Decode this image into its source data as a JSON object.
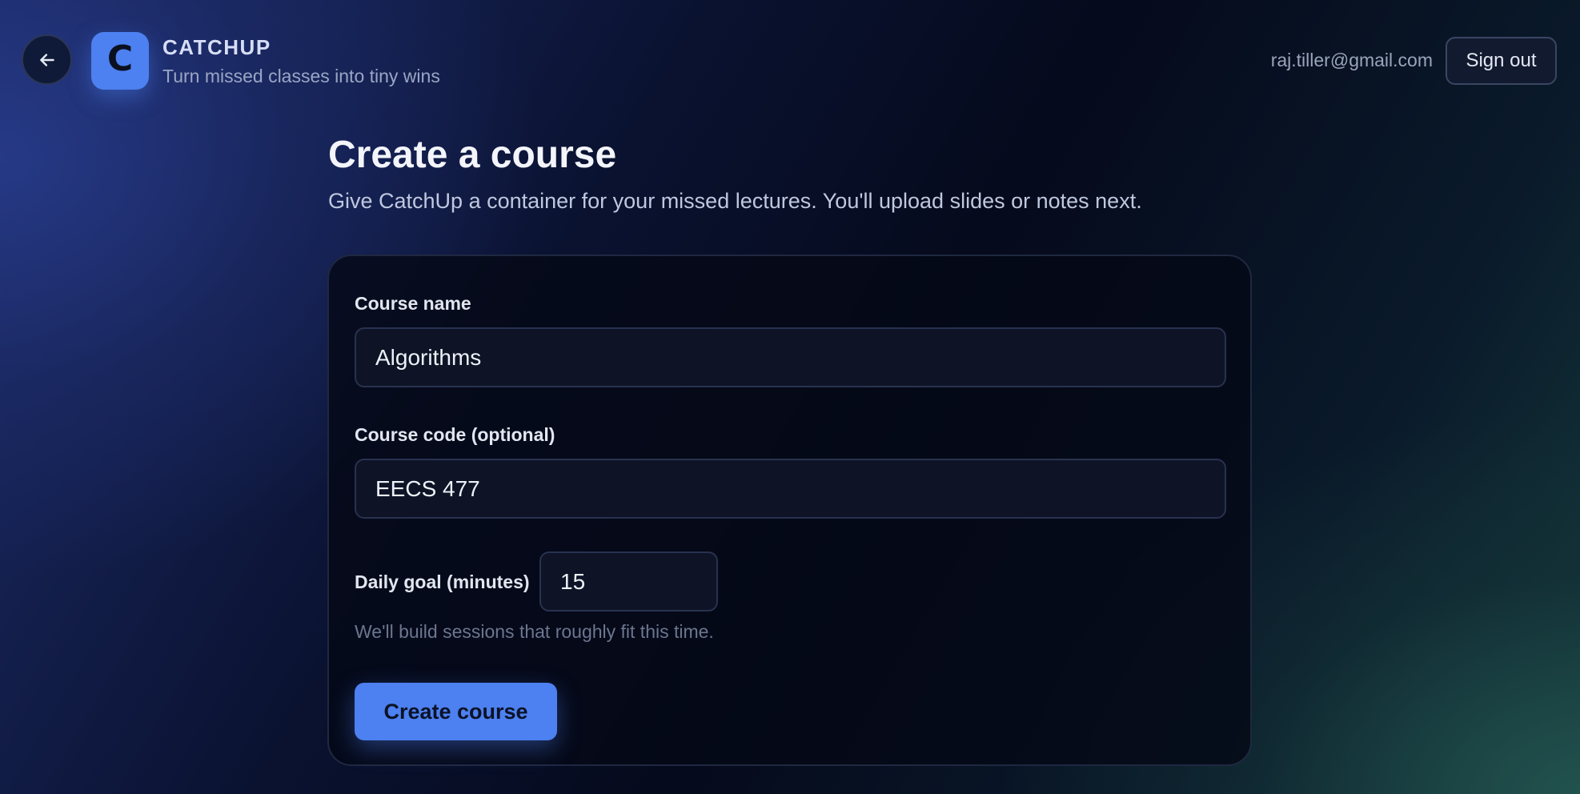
{
  "header": {
    "back_icon": "arrow-left-icon",
    "logo_letter": "C",
    "brand_name": "CATCHUP",
    "tagline": "Turn missed classes into tiny wins",
    "user_email": "raj.tiller@gmail.com",
    "sign_out_label": "Sign out"
  },
  "page": {
    "title": "Create a course",
    "subtitle": "Give CatchUp a container for your missed lectures. You'll upload slides or notes next."
  },
  "form": {
    "course_name": {
      "label": "Course name",
      "value": "Algorithms"
    },
    "course_code": {
      "label": "Course code (optional)",
      "value": "EECS 477"
    },
    "daily_goal": {
      "label": "Daily goal (minutes)",
      "value": "15",
      "hint": "We'll build sessions that roughly fit this time."
    },
    "submit_label": "Create course"
  },
  "colors": {
    "accent": "#4d80f0",
    "card_bg": "#050916",
    "input_bg": "#0e1426"
  }
}
